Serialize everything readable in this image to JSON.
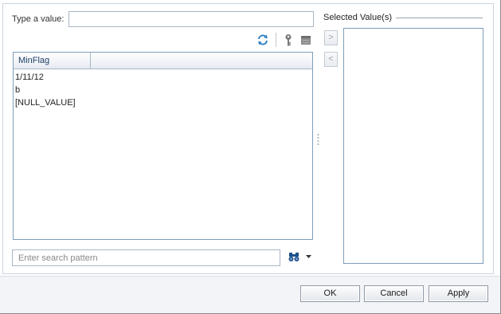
{
  "value_field": {
    "label": "Type a value:",
    "value": ""
  },
  "toolbar": {
    "refresh_icon": "refresh-icon",
    "key_icon": "key-icon",
    "db_icon": "database-icon"
  },
  "list": {
    "column_header": "MinFlag",
    "rows": [
      "1/11/12",
      "b",
      "[NULL_VALUE]"
    ]
  },
  "search": {
    "placeholder": "Enter search pattern",
    "search_icon": "binoculars-icon",
    "dropdown_icon": "chevron-down-icon"
  },
  "move": {
    "add_label": ">",
    "remove_label": "<"
  },
  "selected": {
    "title": "Selected Value(s)",
    "items": []
  },
  "buttons": {
    "ok": "OK",
    "cancel": "Cancel",
    "apply": "Apply"
  },
  "colors": {
    "accent": "#1d3f66",
    "border": "#7f9db9",
    "footer": "#f2f4f7"
  }
}
